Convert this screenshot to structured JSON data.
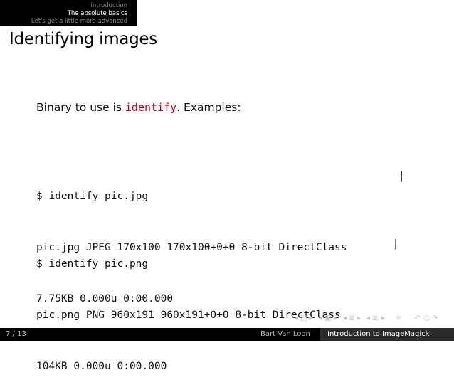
{
  "nav": {
    "sections": [
      {
        "label": "Introduction",
        "active": false
      },
      {
        "label": "The absolute basics",
        "active": true
      },
      {
        "label": "Let's get a little more advanced",
        "active": false
      }
    ]
  },
  "slide": {
    "title": "Identifying images",
    "intro": {
      "before": "Binary to use is ",
      "command": "identify",
      "after": ". Examples:"
    },
    "examples": [
      {
        "prompt_line": "$ identify pic.jpg",
        "output_line1": "pic.jpg JPEG 170x100 170x100+0+0 8-bit DirectClass",
        "continuation": "\\",
        "output_line2": "7.75KB 0.000u 0:00.000"
      },
      {
        "prompt_line": "$ identify pic.png",
        "output_line1": "pic.png PNG 960x191 960x191+0+0 8-bit DirectClass",
        "continuation": "\\",
        "output_line2": "104KB 0.000u 0:00.000"
      }
    ]
  },
  "beamer_nav_icons": [
    "frame-prev-icon",
    "frame-next-icon",
    "subsection-prev-icon",
    "subsection-next-icon",
    "section-prev-icon",
    "section-next-icon",
    "appendix-icon",
    "search-icon"
  ],
  "footer": {
    "page": "7 / 13",
    "author": "Bart Van Loon",
    "talk_title": "Introduction to ImageMagick"
  },
  "colors": {
    "code_accent": "#c0001a",
    "bar_background": "#000000",
    "title_box_background": "#2a2a2a"
  }
}
